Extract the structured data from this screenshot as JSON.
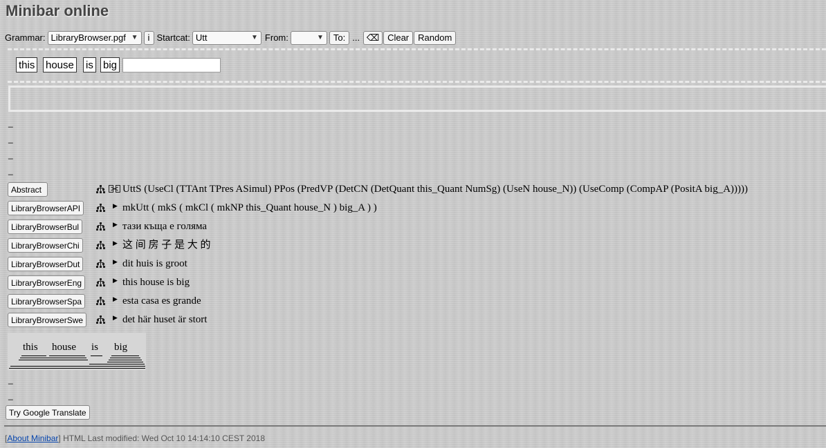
{
  "title": "Minibar online",
  "toolbar": {
    "grammar_label": "Grammar:",
    "grammar_value": "LibraryBrowser.pgf",
    "info_button": "i",
    "startcat_label": "Startcat:",
    "startcat_value": "Utt",
    "from_label": "From:",
    "from_value": "",
    "to_button": "To:",
    "ellipsis": "...",
    "backspace_button": "⌫",
    "clear_button": "Clear",
    "random_button": "Random"
  },
  "sentence_words": [
    "this",
    "house",
    "is",
    "big"
  ],
  "translations": [
    {
      "button": "Abstract",
      "text": "UttS (UseCl (TTAnt TPres ASimul) PPos (PredVP (DetCN (DetQuant this_Quant NumSg) (UseN house_N)) (UseComp (CompAP (PositA big_A)))))"
    },
    {
      "button": "LibraryBrowserAPI",
      "text": "mkUtt ( mkS ( mkCl ( mkNP this_Quant house_N ) big_A ) )"
    },
    {
      "button": "LibraryBrowserBul",
      "text": "тази къща е голяма"
    },
    {
      "button": "LibraryBrowserChi",
      "text": "这 间 房 子 是 大 的"
    },
    {
      "button": "LibraryBrowserDut",
      "text": "dit huis is groot"
    },
    {
      "button": "LibraryBrowserEng",
      "text": "this house is big"
    },
    {
      "button": "LibraryBrowserSpa",
      "text": "esta casa es grande"
    },
    {
      "button": "LibraryBrowserSwe",
      "text": "det här huset är stort"
    }
  ],
  "parse_words": [
    "this",
    "house",
    "is",
    "big"
  ],
  "google_button": "Try Google Translate",
  "footer": {
    "open_bracket": "[",
    "about_link": "About Minibar",
    "close_bracket": "]",
    "modified": " HTML Last modified: Wed Oct 10 14:14:10 CEST 2018"
  },
  "icons": {
    "tree": "tree-icon",
    "align": "word-alignment-icon",
    "expand": "expand-triangle-icon",
    "dropdown": "chevron-down-icon"
  }
}
